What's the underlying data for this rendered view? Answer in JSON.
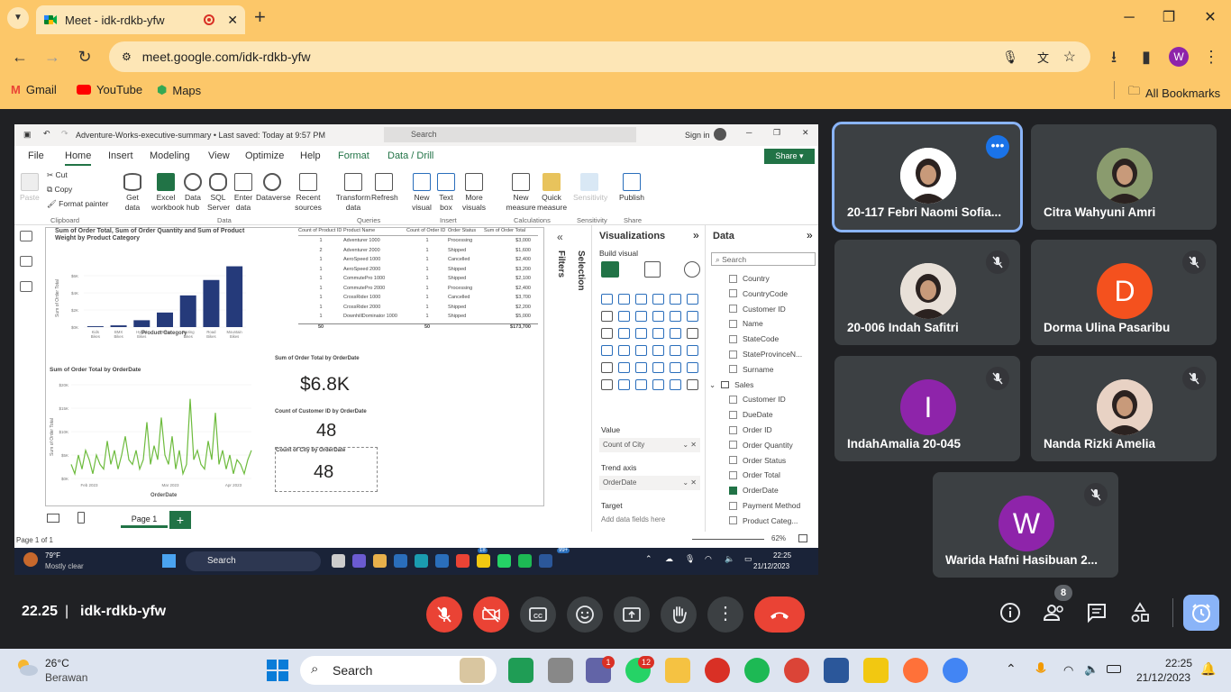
{
  "browser": {
    "tab_title": "Meet - idk-rdkb-yfw",
    "url": "meet.google.com/idk-rdkb-yfw",
    "bookmarks": [
      {
        "label": "Gmail"
      },
      {
        "label": "YouTube"
      },
      {
        "label": "Maps"
      }
    ],
    "all_bookmarks": "All Bookmarks",
    "profile_initial": "W",
    "colors": {
      "frame": "#fcc769",
      "tab": "#fde6b6"
    }
  },
  "powerbi": {
    "file_title": "Adventure-Works-executive-summary • Last saved: Today at 9:57 PM",
    "search_placeholder": "Search",
    "sign_in": "Sign in",
    "tabs": [
      "File",
      "Home",
      "Insert",
      "Modeling",
      "View",
      "Optimize",
      "Help",
      "Format",
      "Data / Drill"
    ],
    "share": "Share",
    "ribbon": {
      "clipboard": {
        "paste": "Paste",
        "cut": "Cut",
        "copy": "Copy",
        "format_painter": "Format painter",
        "group": "Clipboard"
      },
      "data": {
        "get_data": "Get data",
        "excel": "Excel workbook",
        "data_hub": "Data hub",
        "sql": "SQL Server",
        "enter_data": "Enter data",
        "dataverse": "Dataverse",
        "recent": "Recent sources",
        "group": "Data"
      },
      "queries": {
        "transform": "Transform data",
        "refresh": "Refresh",
        "group": "Queries"
      },
      "insert": {
        "new_visual": "New visual",
        "text_box": "Text box",
        "more_visuals": "More visuals",
        "group": "Insert"
      },
      "calculations": {
        "new_measure": "New measure",
        "quick_measure": "Quick measure",
        "group": "Calculations"
      },
      "sensitivity": {
        "label": "Sensitivity",
        "group": "Sensitivity"
      },
      "share": {
        "publish": "Publish",
        "group": "Share"
      }
    },
    "bar_chart": {
      "title": "Sum of Order Total, Sum of Order Quantity and Sum of Product Weight by Product Category",
      "xlabel": "Product Category",
      "ylabel": "Sum of Order Total"
    },
    "table": {
      "headers": [
        "Count of Product ID",
        "Product Name",
        "Count of Order ID",
        "Order Status",
        "Sum of Order Total"
      ],
      "rows": [
        [
          "1",
          "Adventurer 1000",
          "1",
          "Processing",
          "$3,000"
        ],
        [
          "2",
          "Adventurer 2000",
          "1",
          "Shipped",
          "$1,600"
        ],
        [
          "1",
          "AeroSpeed 1000",
          "1",
          "Cancelled",
          "$2,400"
        ],
        [
          "1",
          "AeroSpeed 2000",
          "1",
          "Shipped",
          "$3,200"
        ],
        [
          "1",
          "CommutePro 1000",
          "1",
          "Shipped",
          "$2,100"
        ],
        [
          "1",
          "CommutePro 2000",
          "1",
          "Processing",
          "$2,400"
        ],
        [
          "1",
          "CrossRider 1000",
          "1",
          "Cancelled",
          "$3,700"
        ],
        [
          "1",
          "CrossRider 2000",
          "1",
          "Shipped",
          "$2,200"
        ],
        [
          "1",
          "DownhillDominator 1000",
          "1",
          "Shipped",
          "$5,000"
        ]
      ],
      "totals": [
        "50",
        "",
        "50",
        "",
        "$173,700"
      ]
    },
    "card_total": {
      "label": "Sum of Order Total by OrderDate",
      "value": "$6.8K"
    },
    "card_customer": {
      "label": "Count of Customer ID by OrderDate",
      "value": "48"
    },
    "card_city": {
      "label": "Count of City by OrderDate",
      "value": "48"
    },
    "line_chart": {
      "title": "Sum of Order Total by OrderDate",
      "xlabel": "OrderDate",
      "ylabel": "Sum of Order Total"
    },
    "page_tab": "Page 1",
    "page_count": "Page 1 of 1",
    "zoom": "62%",
    "filters": "Filters",
    "selection": "Selection",
    "visualizations": {
      "title": "Visualizations",
      "build": "Build visual",
      "value_label": "Value",
      "value_field": "Count of City",
      "trend_label": "Trend axis",
      "trend_field": "OrderDate",
      "target_label": "Target",
      "target_placeholder": "Add data fields here"
    },
    "data_pane": {
      "title": "Data",
      "search": "Search",
      "fields": [
        "Country",
        "CountryCode",
        "Customer ID",
        "Name",
        "StateCode",
        "StateProvinceN...",
        "Surname"
      ],
      "sales_table": "Sales",
      "sales_fields": [
        "Customer ID",
        "DueDate",
        "Order ID",
        "Order Quantity",
        "Order Status",
        "Order Total",
        "OrderDate",
        "Payment Method",
        "Product Categ..."
      ]
    },
    "inner_taskbar": {
      "weather_temp": "79°F",
      "weather_desc": "Mostly clear",
      "search": "Search",
      "time": "22:25",
      "date": "21/12/2023",
      "badge1": "18",
      "badge2": "99+"
    }
  },
  "chart_data": [
    {
      "type": "bar",
      "title": "Sum of Order Total, Sum of Order Quantity and Sum of Product Weight by Product Category",
      "xlabel": "Product Category",
      "ylabel": "Sum of Order Total",
      "categories": [
        "Kids Bikes",
        "BMX Bikes",
        "Hybrid Bikes",
        "E-Bikes",
        "Touring Bikes",
        "Road Bikes",
        "Mountain Bikes"
      ],
      "values": [
        0.1,
        0.2,
        0.8,
        1.7,
        3.7,
        5.5,
        7.1
      ],
      "ylim": [
        0,
        8
      ],
      "yticks": [
        "$0K",
        "$2K",
        "$4K",
        "$6K"
      ],
      "color": "#253a7a"
    },
    {
      "type": "line",
      "title": "Sum of Order Total by OrderDate",
      "xlabel": "OrderDate",
      "ylabel": "Sum of Order Total",
      "xticks": [
        "Feb 2023",
        "Mar 2023",
        "Apr 2023"
      ],
      "yticks": [
        "$0K",
        "$5K",
        "$10K",
        "$15K",
        "$20K"
      ],
      "ylim": [
        0,
        20
      ],
      "values": [
        3,
        1,
        5,
        2,
        6,
        4,
        1,
        5,
        3,
        2,
        8,
        3,
        6,
        2,
        5,
        9,
        4,
        3,
        6,
        2,
        4,
        12,
        3,
        7,
        4,
        13,
        5,
        3,
        9,
        2,
        6,
        1,
        3,
        17,
        4,
        6,
        3,
        2,
        8,
        4,
        14,
        3,
        6,
        2,
        5,
        1,
        4,
        3,
        1,
        4,
        6
      ],
      "color": "#6dbb3d"
    }
  ],
  "participants": [
    {
      "name": "20-117 Febri Naomi Sofia...",
      "avatar_color": "#ffffff",
      "initial": "",
      "muted": false,
      "active": true
    },
    {
      "name": "Citra Wahyuni Amri",
      "avatar_color": "#8a9b6e",
      "initial": "",
      "muted": false,
      "active": false
    },
    {
      "name": "20-006 Indah Safitri",
      "avatar_color": "#e8e0d8",
      "initial": "",
      "muted": true,
      "active": false
    },
    {
      "name": "Dorma Ulina Pasaribu",
      "avatar_color": "#f4511e",
      "initial": "D",
      "muted": true,
      "active": false
    },
    {
      "name": "IndahAmalia 20-045",
      "avatar_color": "#8e24aa",
      "initial": "I",
      "muted": true,
      "active": false
    },
    {
      "name": "Nanda Rizki Amelia",
      "avatar_color": "#e8d2c4",
      "initial": "",
      "muted": true,
      "active": false
    },
    {
      "name": "Warida Hafni Hasibuan 2...",
      "avatar_color": "#8e24aa",
      "initial": "W",
      "muted": true,
      "active": false
    }
  ],
  "meet": {
    "time": "22.25",
    "meeting_code": "idk-rdkb-yfw",
    "people_count": "8"
  },
  "windows": {
    "weather_temp": "26°C",
    "weather_desc": "Berawan",
    "search": "Search",
    "time": "22:25",
    "date": "21/12/2023",
    "badge_teams": "1",
    "badge_whatsapp": "12"
  }
}
